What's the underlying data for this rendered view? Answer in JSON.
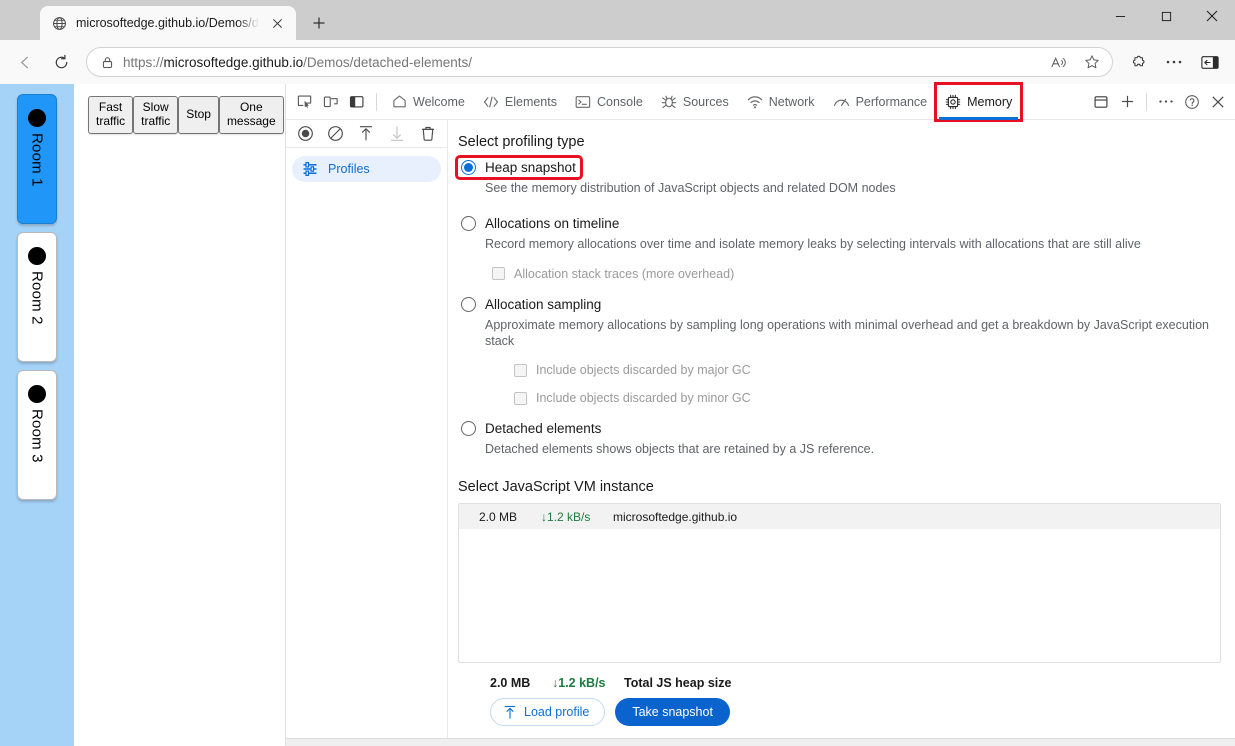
{
  "browser": {
    "tab": {
      "title": "microsoftedge.github.io/Demos/d",
      "favicon_icon": "globe-icon",
      "close_icon": "close-icon"
    },
    "new_tab_icon": "plus-icon",
    "window_controls": {
      "minimize_icon": "minimize-icon",
      "maximize_icon": "maximize-icon",
      "close_icon": "close-icon"
    },
    "toolbar": {
      "back_icon": "back-arrow-icon",
      "refresh_icon": "refresh-icon",
      "lock_icon": "lock-icon",
      "url_scheme": "https://",
      "url_host": "microsoftedge.github.io",
      "url_path": "/Demos/detached-elements/",
      "read_aloud_icon": "read-aloud-icon",
      "favorites_icon": "star-icon",
      "extensions_icon": "puzzle-piece-icon",
      "settings_icon": "ellipsis-icon",
      "sidebar_icon": "sidebar-toggle-icon"
    }
  },
  "page": {
    "rooms": [
      {
        "label": "Room 1",
        "active": true
      },
      {
        "label": "Room 2",
        "active": false
      },
      {
        "label": "Room 3",
        "active": false
      }
    ],
    "buttons": [
      {
        "label": "Fast\ntraffic"
      },
      {
        "label": "Slow\ntraffic"
      },
      {
        "label": "Stop"
      },
      {
        "label": "One\nmessage"
      }
    ]
  },
  "devtools": {
    "left_icons": [
      {
        "name": "inspect-element-icon"
      },
      {
        "name": "device-toolbar-icon"
      },
      {
        "name": "dock-side-icon"
      }
    ],
    "tabs": [
      {
        "label": "Welcome",
        "icon": "home-icon",
        "active": false,
        "highlighted": false
      },
      {
        "label": "Elements",
        "icon": "code-icon",
        "active": false,
        "highlighted": false
      },
      {
        "label": "Console",
        "icon": "console-icon",
        "active": false,
        "highlighted": false
      },
      {
        "label": "Sources",
        "icon": "bug-icon",
        "active": false,
        "highlighted": false
      },
      {
        "label": "Network",
        "icon": "network-icon",
        "active": false,
        "highlighted": false
      },
      {
        "label": "Performance",
        "icon": "performance-icon",
        "active": false,
        "highlighted": false
      },
      {
        "label": "Memory",
        "icon": "memory-chip-icon",
        "active": true,
        "highlighted": true
      }
    ],
    "tab_actions": {
      "drawer_icon": "drawer-icon",
      "more_tabs_icon": "plus-icon",
      "more_options_icon": "ellipsis-icon",
      "help_icon": "question-circle-icon",
      "close_icon": "close-icon"
    },
    "panel_toolbar": [
      {
        "name": "record-icon",
        "disabled": false
      },
      {
        "name": "clear-icon",
        "disabled": false
      },
      {
        "name": "load-profile-icon",
        "disabled": false
      },
      {
        "name": "save-profile-icon",
        "disabled": true
      },
      {
        "name": "delete-profile-icon",
        "disabled": false
      }
    ],
    "sidebar": {
      "items": [
        {
          "label": "Profiles",
          "icon": "sliders-icon",
          "selected": true
        }
      ]
    },
    "memory_panel": {
      "profiling_title": "Select profiling type",
      "options": [
        {
          "label": "Heap snapshot",
          "description": "See the memory distribution of JavaScript objects and related DOM nodes",
          "checked": true,
          "highlighted": true,
          "sub_options": []
        },
        {
          "label": "Allocations on timeline",
          "description": "Record memory allocations over time and isolate memory leaks by selecting intervals with allocations that are still alive",
          "checked": false,
          "highlighted": false,
          "sub_options": [
            {
              "label": "Allocation stack traces (more overhead)",
              "checked": false,
              "indent": 1
            }
          ]
        },
        {
          "label": "Allocation sampling",
          "description": "Approximate memory allocations by sampling long operations with minimal overhead and get a breakdown by JavaScript execution stack",
          "checked": false,
          "highlighted": false,
          "sub_options": [
            {
              "label": "Include objects discarded by major GC",
              "checked": false,
              "indent": 2
            },
            {
              "label": "Include objects discarded by minor GC",
              "checked": false,
              "indent": 2
            }
          ]
        },
        {
          "label": "Detached elements",
          "description": "Detached elements shows objects that are retained by a JS reference.",
          "checked": false,
          "highlighted": false,
          "sub_options": []
        }
      ],
      "vm_title": "Select JavaScript VM instance",
      "vm_instances": [
        {
          "size": "2.0 MB",
          "rate": "1.2 kB/s",
          "rate_arrow": "down-arrow-icon",
          "host": "microsoftedge.github.io"
        }
      ],
      "footer": {
        "total_size": "2.0 MB",
        "total_rate": "1.2 kB/s",
        "total_label": "Total JS heap size",
        "load_profile_label": "Load profile",
        "load_profile_icon": "upload-arrow-icon",
        "take_snapshot_label": "Take snapshot"
      }
    }
  },
  "colors": {
    "accent_blue": "#0b6fd6",
    "primary_button": "#0b63ce",
    "highlight_red": "#e81123",
    "rate_green": "#1f7a3f",
    "room_active": "#2196f9",
    "rail_bg": "#a5d2f7"
  }
}
